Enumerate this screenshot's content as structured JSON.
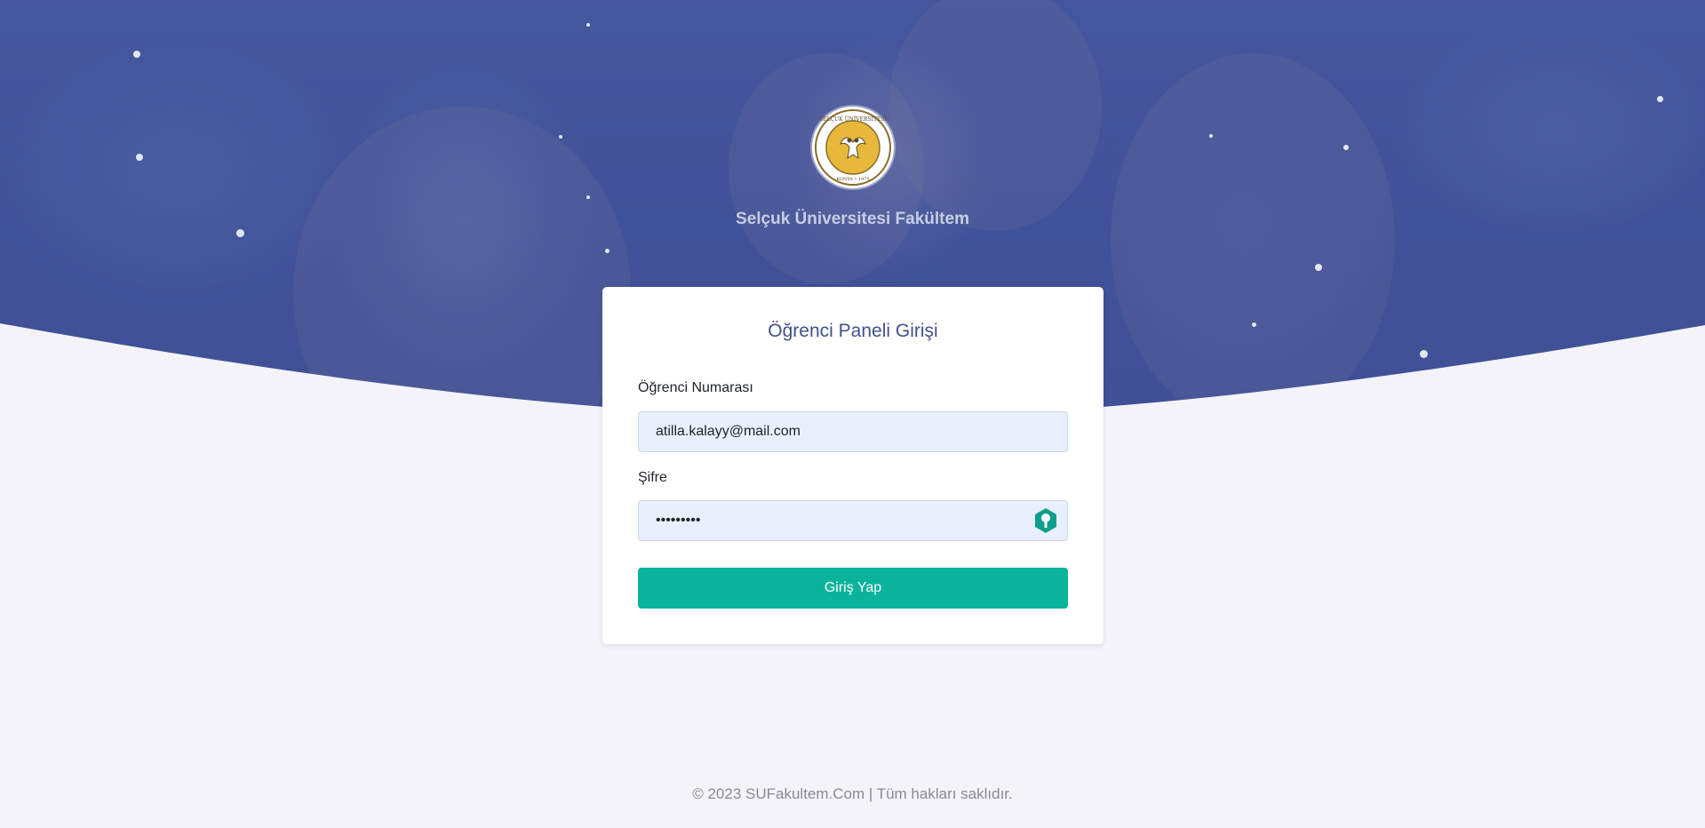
{
  "hero": {
    "brand_title": "Selçuk Üniversitesi Fakültem"
  },
  "logo": {
    "icon": "university-seal-icon",
    "seal_text_top": "SELÇUK ÜNİVERSİTESİ",
    "seal_text_bottom": "KONYA • 1975"
  },
  "login_card": {
    "title": "Öğrenci Paneli Girişi",
    "student_number": {
      "label": "Öğrenci Numarası",
      "value": "atilla.kalayy@mail.com"
    },
    "password": {
      "label": "Şifre",
      "value": "•••••••••",
      "icon": "password-manager-key-icon"
    },
    "submit_label": "Giriş Yap"
  },
  "footer": {
    "copyright": "© 2023 SUFakultem.Com | Tüm hakları saklıdır."
  },
  "colors": {
    "hero_blue": "#405189",
    "accent_green": "#0ab39c",
    "page_bg": "#f3f3f9",
    "title_blue": "#405189"
  }
}
